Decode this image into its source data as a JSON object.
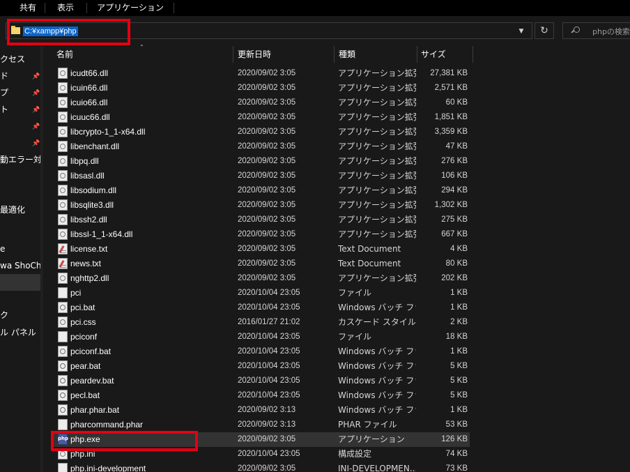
{
  "ribbon": {
    "tabs": [
      "共有",
      "表示",
      "アプリケーション ツール"
    ]
  },
  "address": {
    "path": "C:¥xampp¥php",
    "dropdown_icon": "chevron-down-icon",
    "refresh_icon": "refresh-icon",
    "search_placeholder": "phpの検索"
  },
  "nav": {
    "items": [
      "クセス",
      "ド",
      "プ",
      "ト",
      "",
      "",
      "動エラー対処",
      "最適化",
      "e",
      "wa ShoChan",
      "",
      "ク",
      "ル パネル"
    ]
  },
  "columns": {
    "name": "名前",
    "date": "更新日時",
    "type": "種類",
    "size": "サイズ"
  },
  "files": [
    {
      "name": "icudt66.dll",
      "date": "2020/09/02 3:05",
      "type": "アプリケーション拡張",
      "size": "27,381 KB",
      "icon": "dll"
    },
    {
      "name": "icuin66.dll",
      "date": "2020/09/02 3:05",
      "type": "アプリケーション拡張",
      "size": "2,571 KB",
      "icon": "dll"
    },
    {
      "name": "icuio66.dll",
      "date": "2020/09/02 3:05",
      "type": "アプリケーション拡張",
      "size": "60 KB",
      "icon": "dll"
    },
    {
      "name": "icuuc66.dll",
      "date": "2020/09/02 3:05",
      "type": "アプリケーション拡張",
      "size": "1,851 KB",
      "icon": "dll"
    },
    {
      "name": "libcrypto-1_1-x64.dll",
      "date": "2020/09/02 3:05",
      "type": "アプリケーション拡張",
      "size": "3,359 KB",
      "icon": "dll"
    },
    {
      "name": "libenchant.dll",
      "date": "2020/09/02 3:05",
      "type": "アプリケーション拡張",
      "size": "47 KB",
      "icon": "dll"
    },
    {
      "name": "libpq.dll",
      "date": "2020/09/02 3:05",
      "type": "アプリケーション拡張",
      "size": "276 KB",
      "icon": "dll"
    },
    {
      "name": "libsasl.dll",
      "date": "2020/09/02 3:05",
      "type": "アプリケーション拡張",
      "size": "106 KB",
      "icon": "dll"
    },
    {
      "name": "libsodium.dll",
      "date": "2020/09/02 3:05",
      "type": "アプリケーション拡張",
      "size": "294 KB",
      "icon": "dll"
    },
    {
      "name": "libsqlite3.dll",
      "date": "2020/09/02 3:05",
      "type": "アプリケーション拡張",
      "size": "1,302 KB",
      "icon": "dll"
    },
    {
      "name": "libssh2.dll",
      "date": "2020/09/02 3:05",
      "type": "アプリケーション拡張",
      "size": "275 KB",
      "icon": "dll"
    },
    {
      "name": "libssl-1_1-x64.dll",
      "date": "2020/09/02 3:05",
      "type": "アプリケーション拡張",
      "size": "667 KB",
      "icon": "dll"
    },
    {
      "name": "license.txt",
      "date": "2020/09/02 3:05",
      "type": "Text Document",
      "size": "4 KB",
      "icon": "txt"
    },
    {
      "name": "news.txt",
      "date": "2020/09/02 3:05",
      "type": "Text Document",
      "size": "80 KB",
      "icon": "txt"
    },
    {
      "name": "nghttp2.dll",
      "date": "2020/09/02 3:05",
      "type": "アプリケーション拡張",
      "size": "202 KB",
      "icon": "dll"
    },
    {
      "name": "pci",
      "date": "2020/10/04 23:05",
      "type": "ファイル",
      "size": "1 KB",
      "icon": "file"
    },
    {
      "name": "pci.bat",
      "date": "2020/10/04 23:05",
      "type": "Windows バッチ ファ...",
      "size": "1 KB",
      "icon": "bat"
    },
    {
      "name": "pci.css",
      "date": "2016/01/27 21:02",
      "type": "カスケード スタイル シ...",
      "size": "2 KB",
      "icon": "css"
    },
    {
      "name": "pciconf",
      "date": "2020/10/04 23:05",
      "type": "ファイル",
      "size": "18 KB",
      "icon": "file"
    },
    {
      "name": "pciconf.bat",
      "date": "2020/10/04 23:05",
      "type": "Windows バッチ ファ...",
      "size": "1 KB",
      "icon": "bat"
    },
    {
      "name": "pear.bat",
      "date": "2020/10/04 23:05",
      "type": "Windows バッチ ファ...",
      "size": "5 KB",
      "icon": "bat"
    },
    {
      "name": "peardev.bat",
      "date": "2020/10/04 23:05",
      "type": "Windows バッチ ファ...",
      "size": "5 KB",
      "icon": "bat"
    },
    {
      "name": "pecl.bat",
      "date": "2020/10/04 23:05",
      "type": "Windows バッチ ファ...",
      "size": "5 KB",
      "icon": "bat"
    },
    {
      "name": "phar.phar.bat",
      "date": "2020/09/02 3:13",
      "type": "Windows バッチ ファ...",
      "size": "1 KB",
      "icon": "bat"
    },
    {
      "name": "pharcommand.phar",
      "date": "2020/09/02 3:13",
      "type": "PHAR ファイル",
      "size": "53 KB",
      "icon": "file"
    },
    {
      "name": "php.exe",
      "date": "2020/09/02 3:05",
      "type": "アプリケーション",
      "size": "126 KB",
      "icon": "exe",
      "selected": true
    },
    {
      "name": "php.ini",
      "date": "2020/10/04 23:05",
      "type": "構成設定",
      "size": "74 KB",
      "icon": "ini"
    },
    {
      "name": "php.ini-development",
      "date": "2020/09/02 3:05",
      "type": "INI-DEVELOPMEN...",
      "size": "73 KB",
      "icon": "file"
    }
  ]
}
